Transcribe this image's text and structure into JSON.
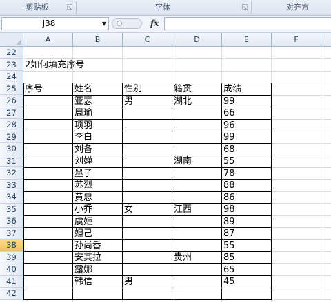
{
  "ribbon": {
    "groups": [
      "剪贴板",
      "字体",
      "对齐方"
    ]
  },
  "formula_bar": {
    "name_box": "J38",
    "fx_label": "fx",
    "formula_value": ""
  },
  "grid": {
    "columns": [
      "A",
      "B",
      "C",
      "D",
      "E",
      "F"
    ],
    "rows": [
      "22",
      "23",
      "24",
      "25",
      "26",
      "27",
      "28",
      "29",
      "30",
      "31",
      "32",
      "33",
      "34",
      "35",
      "36",
      "37",
      "38",
      "39",
      "40",
      "41",
      "42"
    ],
    "active_row": "38",
    "title_cell": "2如何填充序号",
    "table": {
      "headers": [
        "序号",
        "姓名",
        "性别",
        "籍贯",
        "成绩"
      ],
      "rows": [
        [
          "",
          "亚瑟",
          "男",
          "湖北",
          "99"
        ],
        [
          "",
          "周瑜",
          "",
          "",
          "66"
        ],
        [
          "",
          "项羽",
          "",
          "",
          "96"
        ],
        [
          "",
          "李白",
          "",
          "",
          "99"
        ],
        [
          "",
          "刘备",
          "",
          "",
          "68"
        ],
        [
          "",
          "刘婵",
          "",
          "湖南",
          "55"
        ],
        [
          "",
          "墨子",
          "",
          "",
          "78"
        ],
        [
          "",
          "苏烈",
          "",
          "",
          "88"
        ],
        [
          "",
          "黄忠",
          "",
          "",
          "86"
        ],
        [
          "",
          "小乔",
          "女",
          "江西",
          "98"
        ],
        [
          "",
          "虞姬",
          "",
          "",
          "89"
        ],
        [
          "",
          "妲己",
          "",
          "",
          "87"
        ],
        [
          "",
          "孙尚香",
          "",
          "",
          "55"
        ],
        [
          "",
          "安其拉",
          "",
          "贵州",
          "85"
        ],
        [
          "",
          "露娜",
          "",
          "",
          "65"
        ],
        [
          "",
          "韩信",
          "男",
          "",
          "45"
        ]
      ]
    }
  }
}
